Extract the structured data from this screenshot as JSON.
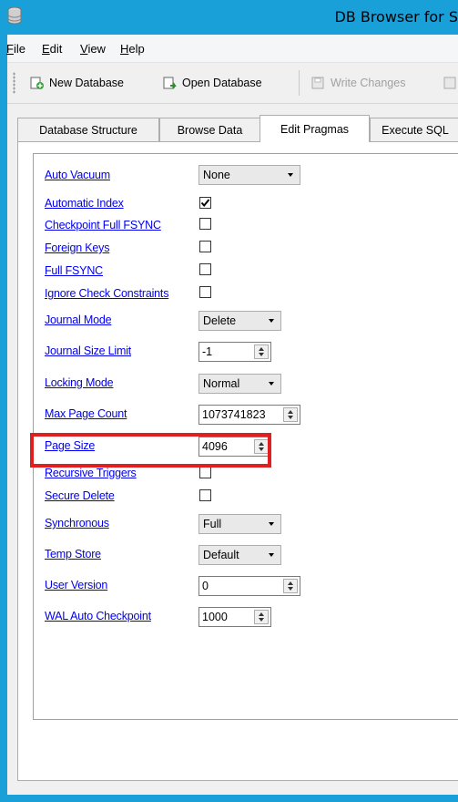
{
  "window": {
    "title": "DB Browser for S"
  },
  "menubar": [
    {
      "label": "File",
      "underline": "F",
      "rest": "ile"
    },
    {
      "label": "Edit",
      "underline": "E",
      "rest": "dit"
    },
    {
      "label": "View",
      "underline": "V",
      "rest": "iew"
    },
    {
      "label": "Help",
      "underline": "H",
      "rest": "elp"
    }
  ],
  "toolbar": {
    "new_database": "New Database",
    "open_database": "Open Database",
    "write_changes": "Write Changes"
  },
  "tabs": [
    "Database Structure",
    "Browse Data",
    "Edit Pragmas",
    "Execute SQL"
  ],
  "active_tab": "Edit Pragmas",
  "pragmas": {
    "auto_vacuum": {
      "label": "Auto Vacuum",
      "value": "None"
    },
    "automatic_index": {
      "label": "Automatic Index",
      "checked": true
    },
    "checkpoint_full_fsync": {
      "label": "Checkpoint Full FSYNC",
      "checked": false
    },
    "foreign_keys": {
      "label": "Foreign Keys",
      "checked": false
    },
    "full_fsync": {
      "label": "Full FSYNC",
      "checked": false
    },
    "ignore_check_constraints": {
      "label": "Ignore Check Constraints",
      "checked": false
    },
    "journal_mode": {
      "label": "Journal Mode",
      "value": "Delete"
    },
    "journal_size_limit": {
      "label": "Journal Size Limit",
      "value": "-1"
    },
    "locking_mode": {
      "label": "Locking Mode",
      "value": "Normal"
    },
    "max_page_count": {
      "label": "Max Page Count",
      "value": "1073741823"
    },
    "page_size": {
      "label": "Page Size",
      "value": "4096"
    },
    "recursive_triggers": {
      "label": "Recursive Triggers",
      "checked": false
    },
    "secure_delete": {
      "label": "Secure Delete",
      "checked": false
    },
    "synchronous": {
      "label": "Synchronous",
      "value": "Full"
    },
    "temp_store": {
      "label": "Temp Store",
      "value": "Default"
    },
    "user_version": {
      "label": "User Version",
      "value": "0"
    },
    "wal_auto_checkpoint": {
      "label": "WAL Auto Checkpoint",
      "value": "1000"
    }
  },
  "colors": {
    "titlebar": "#1aa0d8",
    "link": "#0000ee",
    "highlight": "#e02020"
  }
}
